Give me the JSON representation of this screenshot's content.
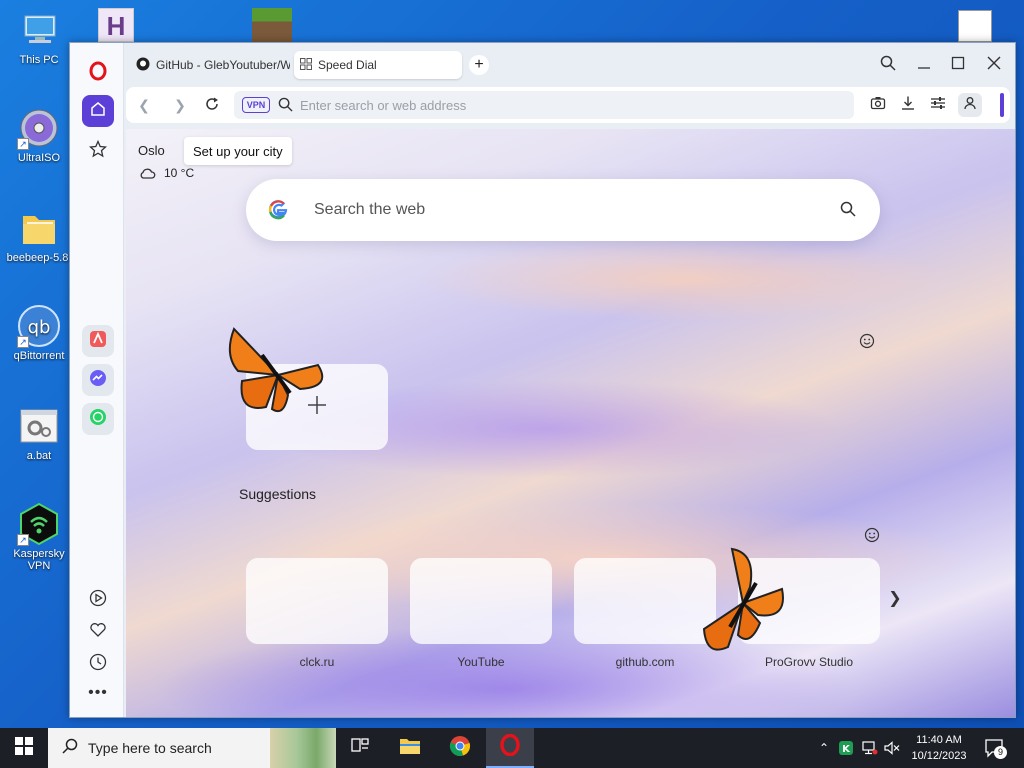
{
  "desktop": {
    "icons": [
      {
        "label": "This PC"
      },
      {
        "label": "UltraISO"
      },
      {
        "label": "beebeep-5.8."
      },
      {
        "label": "qBittorrent"
      },
      {
        "label": "a.bat"
      },
      {
        "label": "Kaspersky VPN"
      }
    ]
  },
  "browser": {
    "tabs": [
      {
        "title": "GitHub - GlebYoutuber/W",
        "icon": "github-icon"
      },
      {
        "title": "Speed Dial",
        "icon": "speed-dial-icon"
      }
    ],
    "address": {
      "vpn_label": "VPN",
      "placeholder": "Enter search or web address"
    },
    "weather": {
      "city": "Oslo",
      "tooltip": "Set up your city",
      "temperature": "10 °C"
    },
    "search": {
      "placeholder": "Search the web"
    },
    "suggestions": {
      "title": "Suggestions",
      "items": [
        {
          "label": "clck.ru"
        },
        {
          "label": "YouTube"
        },
        {
          "label": "github.com"
        },
        {
          "label": "ProGrovv Studio"
        }
      ]
    }
  },
  "taskbar": {
    "search_placeholder": "Type here to search",
    "time": "11:40 AM",
    "date": "10/12/2023",
    "notification_count": "9"
  },
  "colors": {
    "accent": "#5b3fd6",
    "opera_red": "#e3121b",
    "desktop_bg": "#1560c8",
    "taskbar_bg": "#1c1f26"
  }
}
